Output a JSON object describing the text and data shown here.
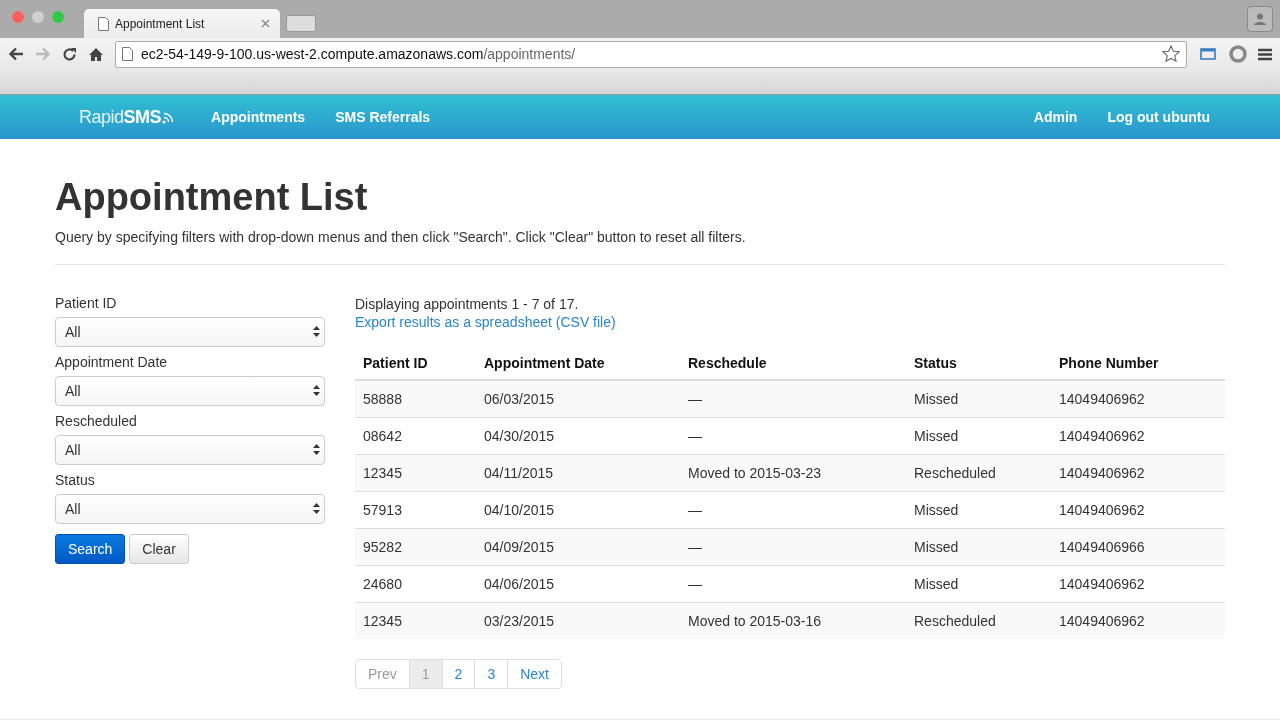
{
  "browser": {
    "tab_title": "Appointment List",
    "url_host": "ec2-54-149-9-100.us-west-2.compute.amazonaws.com",
    "url_path": "/appointments/"
  },
  "navbar": {
    "logo": "Rapid**SMS**",
    "links": [
      {
        "label": "Appointments"
      },
      {
        "label": "SMS Referrals"
      }
    ],
    "right_links": [
      {
        "label": "Admin"
      },
      {
        "label": "Log out ubuntu"
      }
    ]
  },
  "page": {
    "title": "Appointment List",
    "description": "Query by specifying filters with drop-down menus and then click \"Search\". Click \"Clear\" button to reset all filters."
  },
  "filters": [
    {
      "label": "Patient ID",
      "value": "All"
    },
    {
      "label": "Appointment Date",
      "value": "All"
    },
    {
      "label": "Rescheduled",
      "value": "All"
    },
    {
      "label": "Status",
      "value": "All"
    }
  ],
  "buttons": [
    {
      "label": "Search",
      "kind": "primary"
    },
    {
      "label": "Clear",
      "kind": "default"
    }
  ],
  "results": {
    "summary": "Displaying appointments 1 - 7 of 17.",
    "export_link": "Export results as a spreadsheet (CSV file)"
  },
  "table": {
    "columns": [
      "Patient ID",
      "Appointment Date",
      "Reschedule",
      "Status",
      "Phone Number"
    ],
    "rows": [
      [
        "58888",
        "06/03/2015",
        "—",
        "Missed",
        "14049406962"
      ],
      [
        "08642",
        "04/30/2015",
        "—",
        "Missed",
        "14049406962"
      ],
      [
        "12345",
        "04/11/2015",
        "Moved to 2015-03-23",
        "Rescheduled",
        "14049406962"
      ],
      [
        "57913",
        "04/10/2015",
        "—",
        "Missed",
        "14049406962"
      ],
      [
        "95282",
        "04/09/2015",
        "—",
        "Missed",
        "14049406966"
      ],
      [
        "24680",
        "04/06/2015",
        "—",
        "Missed",
        "14049406962"
      ],
      [
        "12345",
        "03/23/2015",
        "Moved to 2015-03-16",
        "Rescheduled",
        "14049406962"
      ]
    ]
  },
  "pagination": [
    {
      "label": "Prev",
      "selected": false,
      "disabled": true
    },
    {
      "label": "1",
      "selected": true,
      "disabled": false
    },
    {
      "label": "2",
      "selected": false,
      "disabled": false
    },
    {
      "label": "3",
      "selected": false,
      "disabled": false
    },
    {
      "label": "Next",
      "selected": false,
      "disabled": false
    }
  ]
}
